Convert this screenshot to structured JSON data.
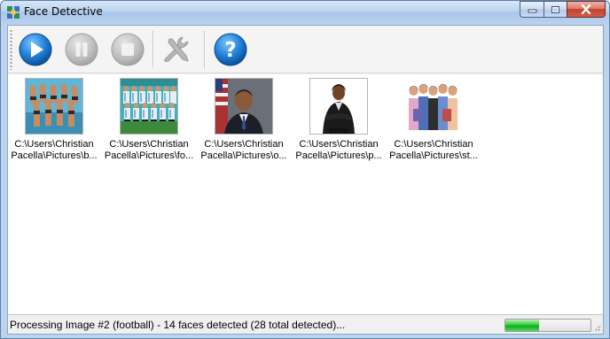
{
  "window": {
    "title": "Face Detective",
    "icons": {
      "app": "face-detective-app-icon",
      "minimize": "minimize-icon",
      "maximize": "maximize-icon",
      "close": "close-icon"
    }
  },
  "toolbar": {
    "buttons": [
      {
        "name": "play",
        "icon": "play-icon",
        "color": "#1f7fd6",
        "enabled": true
      },
      {
        "name": "pause",
        "icon": "pause-icon",
        "color": "#b5b5b5",
        "enabled": false
      },
      {
        "name": "stop",
        "icon": "stop-icon",
        "color": "#b5b5b5",
        "enabled": false
      },
      {
        "name": "settings",
        "icon": "tools-icon",
        "color": "#b5b5b5",
        "enabled": false
      },
      {
        "name": "help",
        "icon": "help-icon",
        "color": "#1f7fd6",
        "enabled": true
      }
    ]
  },
  "images": [
    {
      "line1": "C:\\Users\\Christian",
      "line2": "Pacella\\Pictures\\b...",
      "subject": "group-in-swimsuits"
    },
    {
      "line1": "C:\\Users\\Christian",
      "line2": "Pacella\\Pictures\\fo...",
      "subject": "football-team"
    },
    {
      "line1": "C:\\Users\\Christian",
      "line2": "Pacella\\Pictures\\o...",
      "subject": "portrait-with-flag"
    },
    {
      "line1": "C:\\Users\\Christian",
      "line2": "Pacella\\Pictures\\p...",
      "subject": "woman-arms-crossed"
    },
    {
      "line1": "C:\\Users\\Christian",
      "line2": "Pacella\\Pictures\\st...",
      "subject": "group-of-students"
    }
  ],
  "status": {
    "text": "Processing Image #2 (football) - 14 faces detected (28 total detected)...",
    "progress_fraction": 0.4,
    "progress_color": "#06b025"
  }
}
